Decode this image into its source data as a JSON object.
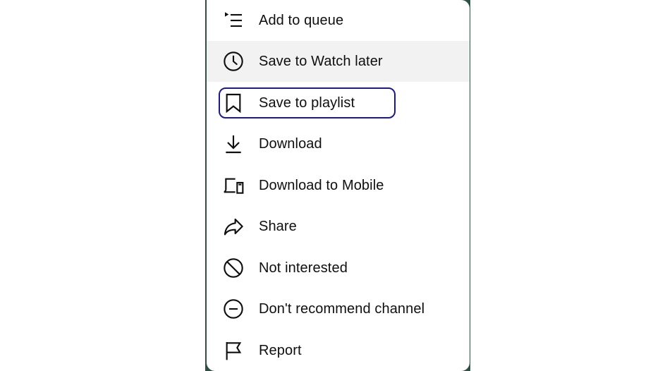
{
  "menu": {
    "items": [
      {
        "id": "add-to-queue",
        "label": "Add to queue",
        "icon": "add-to-queue-icon"
      },
      {
        "id": "save-to-watch-later",
        "label": "Save to Watch later",
        "icon": "clock-icon"
      },
      {
        "id": "save-to-playlist",
        "label": "Save to playlist",
        "icon": "bookmark-icon"
      },
      {
        "id": "download",
        "label": "Download",
        "icon": "download-icon"
      },
      {
        "id": "download-to-mobile",
        "label": "Download to Mobile",
        "icon": "devices-icon"
      },
      {
        "id": "share",
        "label": "Share",
        "icon": "share-icon"
      },
      {
        "id": "not-interested",
        "label": "Not interested",
        "icon": "block-icon"
      },
      {
        "id": "dont-recommend-channel",
        "label": "Don't recommend channel",
        "icon": "remove-circle-icon"
      },
      {
        "id": "report",
        "label": "Report",
        "icon": "flag-icon"
      }
    ],
    "hovered_item": "save-to-watch-later",
    "focused_item": "save-to-playlist"
  },
  "colors": {
    "text": "#0f0f0f",
    "hover_bg": "#f2f2f2",
    "focus_ring": "#1a1a8c",
    "backdrop": "#2f4f45"
  }
}
